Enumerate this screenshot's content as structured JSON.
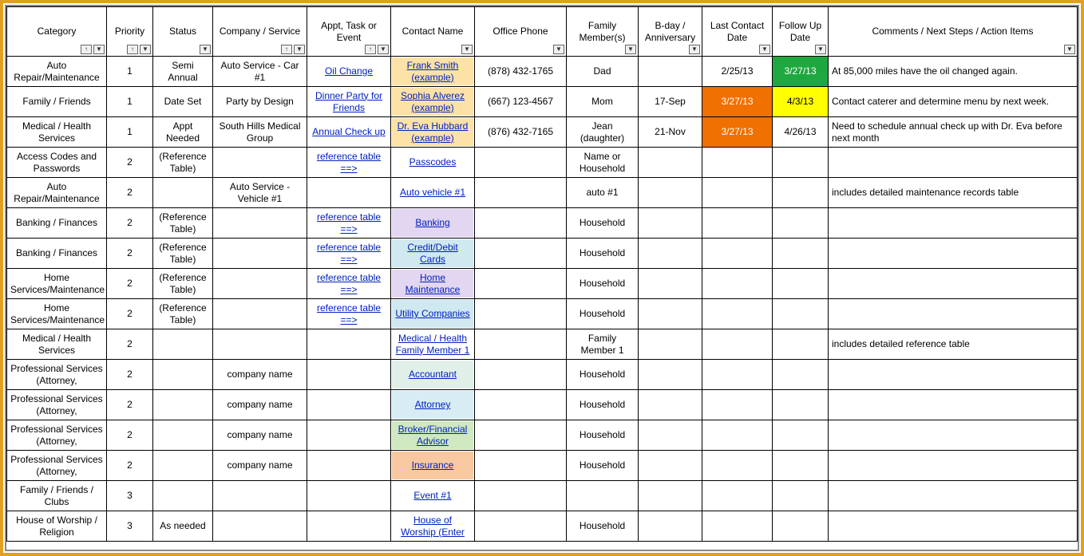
{
  "headers": {
    "category": "Category",
    "priority": "Priority",
    "status": "Status",
    "company": "Company / Service",
    "appt": "Appt, Task or Event",
    "contact": "Contact Name",
    "office": "Office Phone",
    "family": "Family Member(s)",
    "bday": "B-day / Anniversary",
    "lastcontact": "Last Contact Date",
    "followup": "Follow Up Date",
    "comments": "Comments / Next Steps / Action Items"
  },
  "rows": [
    {
      "category": "Auto Repair/Maintenance",
      "priority": "1",
      "status": "Semi Annual",
      "company": "Auto Service - Car #1",
      "appt": "Oil Change",
      "apptLink": true,
      "contact": "Frank Smith (example)",
      "contactBg": "#fde2a8",
      "contactColor": "#0020c0",
      "office": "(878) 432-1765",
      "family": "Dad",
      "bday": "",
      "lastcontact": "2/25/13",
      "lastcontactBg": "",
      "followup": "3/27/13",
      "followupBg": "#1fa83f",
      "followupColor": "#fff",
      "comments": "At 85,000 miles have the oil changed again."
    },
    {
      "category": "Family / Friends",
      "priority": "1",
      "status": "Date Set",
      "company": "Party by Design",
      "appt": "Dinner Party for Friends",
      "apptLink": true,
      "contact": "Sophia Alverez (example)",
      "contactBg": "#fde2a8",
      "contactColor": "#0020c0",
      "office": "(667) 123-4567",
      "family": "Mom",
      "bday": "17-Sep",
      "lastcontact": "3/27/13",
      "lastcontactBg": "#f07000",
      "lastcontactColor": "#fff",
      "followup": "4/3/13",
      "followupBg": "#ffff00",
      "followupColor": "#000",
      "comments": "Contact caterer and determine menu by next week."
    },
    {
      "category": "Medical / Health Services",
      "priority": "1",
      "status": "Appt Needed",
      "company": "South Hills Medical Group",
      "appt": "Annual Check up",
      "apptLink": true,
      "contact": "Dr. Eva Hubbard (example)",
      "contactBg": "#fde2a8",
      "contactColor": "#0020c0",
      "office": "(876) 432-7165",
      "family": "Jean (daughter)",
      "bday": "21-Nov",
      "lastcontact": "3/27/13",
      "lastcontactBg": "#f07000",
      "lastcontactColor": "#fff",
      "followup": "4/26/13",
      "followupBg": "",
      "comments": "Need to schedule annual check up with Dr. Eva before next month"
    },
    {
      "category": "Access Codes and Passwords",
      "priority": "2",
      "status": "(Reference Table)",
      "company": "",
      "appt": "reference table ==>",
      "apptLink": true,
      "contact": "Passcodes ",
      "contactBg": "",
      "contactColor": "#0020c0",
      "office": "",
      "family": "Name or Household",
      "bday": "",
      "lastcontact": "",
      "followup": "",
      "comments": ""
    },
    {
      "category": "Auto Repair/Maintenance",
      "priority": "2",
      "status": "",
      "company": "Auto Service - Vehicle #1",
      "appt": "",
      "apptLink": false,
      "contact": "Auto vehicle #1",
      "contactBg": "",
      "contactColor": "#0020c0",
      "office": "",
      "family": "auto #1",
      "bday": "",
      "lastcontact": "",
      "followup": "",
      "comments": "includes detailed maintenance records table"
    },
    {
      "category": "Banking / Finances",
      "priority": "2",
      "status": "(Reference Table)",
      "company": "",
      "appt": "reference table ==>",
      "apptLink": true,
      "contact": "Banking ",
      "contactBg": "#e2d6f0",
      "contactColor": "#0020c0",
      "office": "",
      "family": "Household",
      "bday": "",
      "lastcontact": "",
      "followup": "",
      "comments": ""
    },
    {
      "category": "Banking / Finances",
      "priority": "2",
      "status": "(Reference Table)",
      "company": "",
      "appt": "reference table ==>",
      "apptLink": true,
      "contact": "Credit/Debit Cards ",
      "contactBg": "#d0e8f0",
      "contactColor": "#0020c0",
      "office": "",
      "family": "Household",
      "bday": "",
      "lastcontact": "",
      "followup": "",
      "comments": ""
    },
    {
      "category": "Home Services/Maintenance",
      "priority": "2",
      "status": "(Reference Table)",
      "company": "",
      "appt": "reference table ==>",
      "apptLink": true,
      "contact": "Home Maintenance ",
      "contactBg": "#e2d6f0",
      "contactColor": "#0020c0",
      "office": "",
      "family": "Household",
      "bday": "",
      "lastcontact": "",
      "followup": "",
      "comments": ""
    },
    {
      "category": "Home Services/Maintenance",
      "priority": "2",
      "status": "(Reference Table)",
      "company": "",
      "appt": "reference table ==>",
      "apptLink": true,
      "contact": "Utility Companies ",
      "contactBg": "#d0e8f0",
      "contactColor": "#0020c0",
      "office": "",
      "family": "Household",
      "bday": "",
      "lastcontact": "",
      "followup": "",
      "comments": ""
    },
    {
      "category": "Medical / Health Services",
      "priority": "2",
      "status": "",
      "company": "",
      "appt": "",
      "apptLink": false,
      "contact": "Medical / Health Family Member 1",
      "contactBg": "",
      "contactColor": "#0020c0",
      "office": "",
      "family": "Family Member 1",
      "bday": "",
      "lastcontact": "",
      "followup": "",
      "comments": "includes detailed reference table"
    },
    {
      "category": "Professional Services (Attorney,",
      "priority": "2",
      "status": "",
      "company": "company name",
      "appt": "",
      "apptLink": false,
      "contact": "Accountant ",
      "contactBg": "#e0f0e8",
      "contactColor": "#0020c0",
      "office": "",
      "family": "Household",
      "bday": "",
      "lastcontact": "",
      "followup": "",
      "comments": ""
    },
    {
      "category": "Professional Services (Attorney,",
      "priority": "2",
      "status": "",
      "company": "company name",
      "appt": "",
      "apptLink": false,
      "contact": "Attorney ",
      "contactBg": "#d8ecf4",
      "contactColor": "#0020c0",
      "office": "",
      "family": "Household",
      "bday": "",
      "lastcontact": "",
      "followup": "",
      "comments": ""
    },
    {
      "category": "Professional Services (Attorney,",
      "priority": "2",
      "status": "",
      "company": "company name",
      "appt": "",
      "apptLink": false,
      "contact": "Broker/Financial Advisor ",
      "contactBg": "#d0e8c0",
      "contactColor": "#0020c0",
      "office": "",
      "family": "Household",
      "bday": "",
      "lastcontact": "",
      "followup": "",
      "comments": ""
    },
    {
      "category": "Professional Services (Attorney,",
      "priority": "2",
      "status": "",
      "company": "company name",
      "appt": "",
      "apptLink": false,
      "contact": "Insurance ",
      "contactBg": "#f8c8a0",
      "contactColor": "#0020c0",
      "office": "",
      "family": "Household",
      "bday": "",
      "lastcontact": "",
      "followup": "",
      "comments": ""
    },
    {
      "category": "Family / Friends / Clubs",
      "priority": "3",
      "status": "",
      "company": "",
      "appt": "",
      "apptLink": false,
      "contact": "Event #1 ",
      "contactBg": "",
      "contactColor": "#0020c0",
      "office": "",
      "family": "",
      "bday": "",
      "lastcontact": "",
      "followup": "",
      "comments": ""
    },
    {
      "category": "House of Worship / Religion",
      "priority": "3",
      "status": "As needed",
      "company": "",
      "appt": "",
      "apptLink": false,
      "contact": "House of Worship (Enter ",
      "contactBg": "",
      "contactColor": "#0020c0",
      "office": "",
      "family": "Household",
      "bday": "",
      "lastcontact": "",
      "followup": "",
      "comments": ""
    }
  ]
}
